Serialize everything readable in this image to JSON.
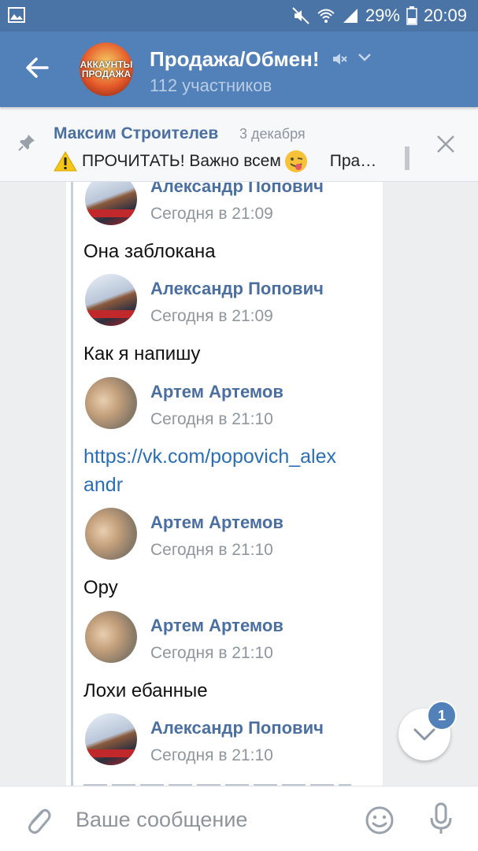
{
  "status_bar": {
    "battery": "29%",
    "time": "20:09"
  },
  "header": {
    "title": "Продажа/Обмен!",
    "subtitle": "112 участников",
    "avatar_text": "АККАУНТЫ ПРОДАЖА"
  },
  "pinned": {
    "author": "Максим Строителев",
    "date": "3 декабря",
    "text": "ПРОЧИТАТЬ! Важно всем",
    "more": "Пра…"
  },
  "messages": [
    {
      "author": "Александр Попович",
      "time": "Сегодня в 21:09",
      "text": "Она заблокана"
    },
    {
      "author": "Александр Попович",
      "time": "Сегодня в 21:09",
      "text": "Как я напишу"
    },
    {
      "author": "Артем Артемов",
      "time": "Сегодня в 21:10",
      "text": "https://vk.com/popovich_alexandr"
    },
    {
      "author": "Артем Артемов",
      "time": "Сегодня в 21:10",
      "text": "Ору"
    },
    {
      "author": "Артем Артемов",
      "time": "Сегодня в 21:10",
      "text": "Лохи ебанные"
    },
    {
      "author": "Александр Попович",
      "time": "Сегодня в 21:10"
    }
  ],
  "scroll_badge": "1",
  "composer": {
    "placeholder": "Ваше сообщение"
  },
  "colors": {
    "header": "#5181b8",
    "status_bar": "#4a74a6",
    "link": "#2a6fb6",
    "author": "#4a6fa0"
  }
}
